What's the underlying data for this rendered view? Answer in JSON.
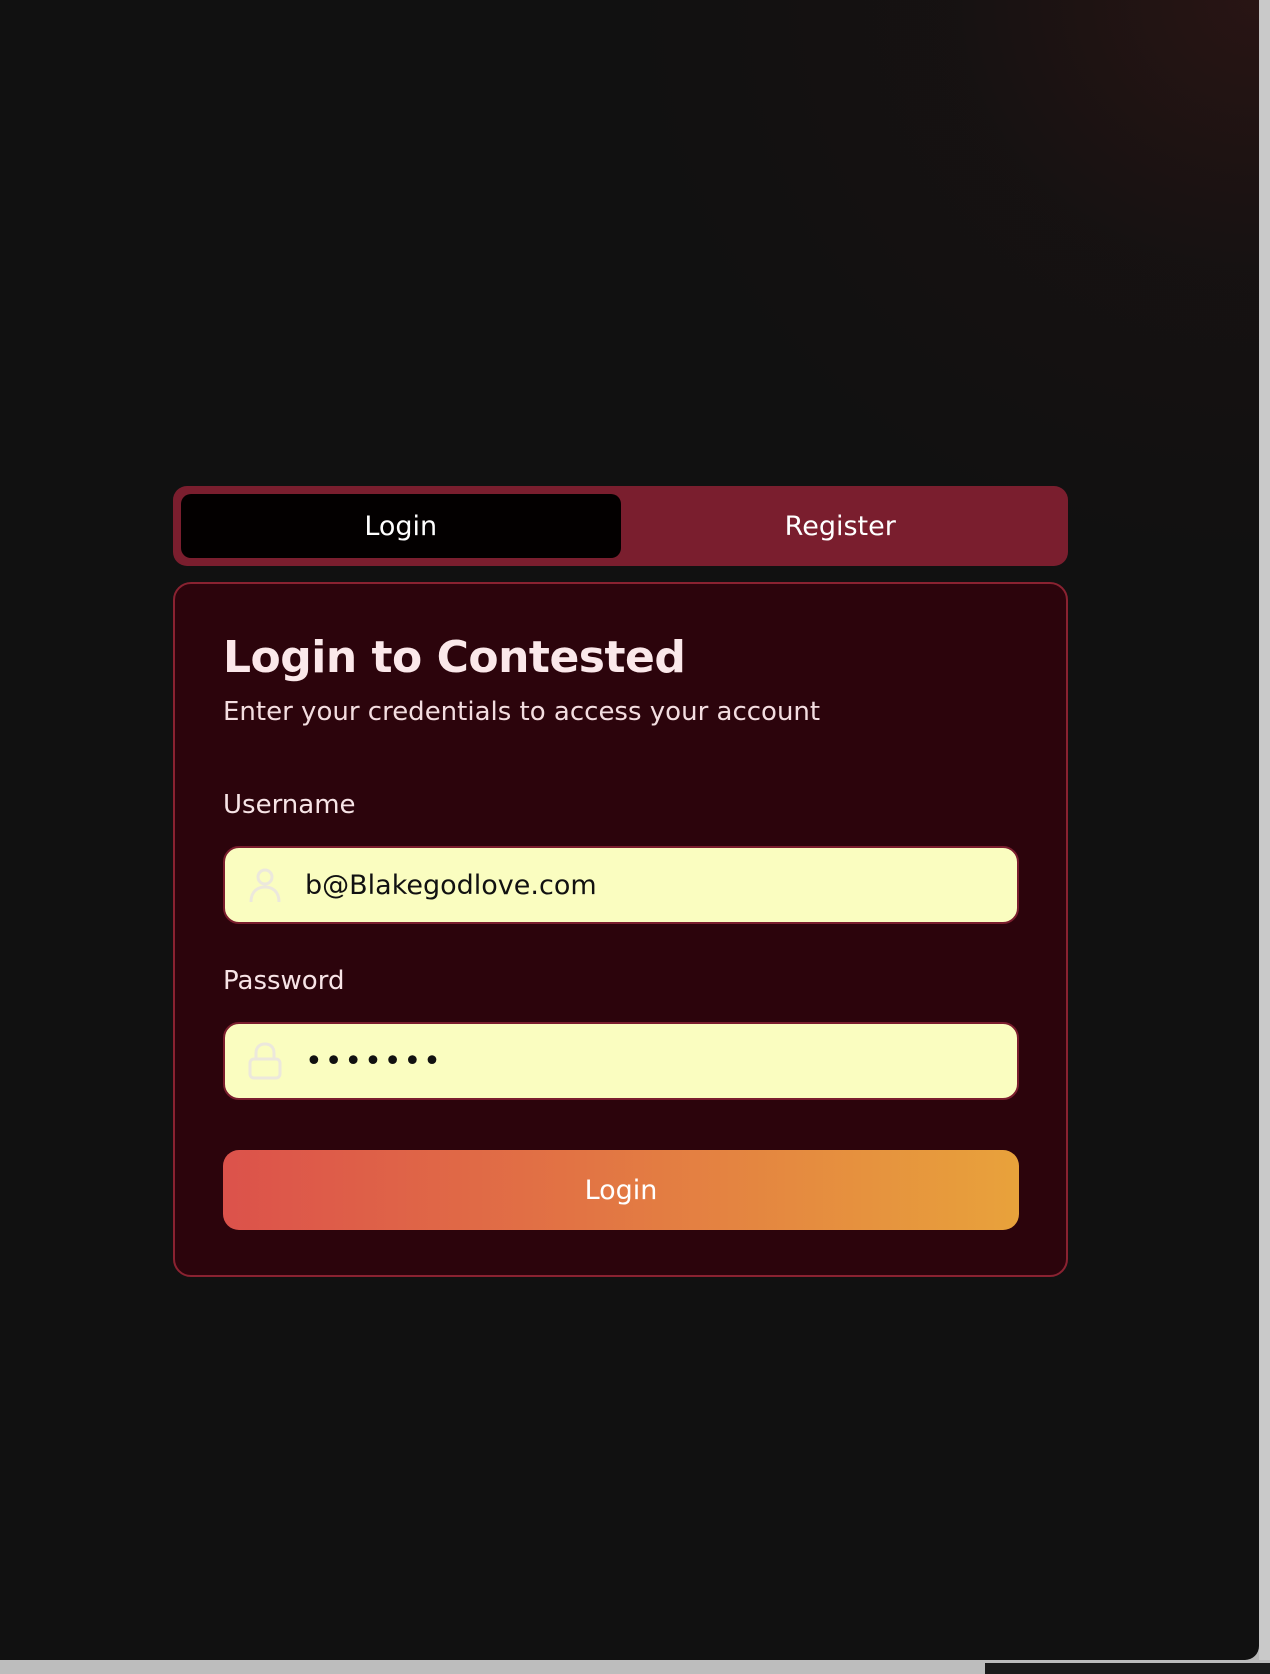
{
  "tabs": {
    "login": "Login",
    "register": "Register"
  },
  "card": {
    "title": "Login to Contested",
    "subtitle": "Enter your credentials to access your account"
  },
  "form": {
    "username_label": "Username",
    "username_value": "b@Blakegodlove.com",
    "password_label": "Password",
    "password_value": "•••••••",
    "submit_label": "Login"
  },
  "icons": {
    "username": "user-icon",
    "password": "lock-icon"
  },
  "colors": {
    "page_background": "#111111",
    "tab_bar": "#7a1e2e",
    "tab_active": "#030000",
    "card_background": "#2c040c",
    "card_border": "#8a2231",
    "input_background": "#fafdc0",
    "button_gradient_start": "#dc524b",
    "button_gradient_end": "#e8a23b"
  }
}
